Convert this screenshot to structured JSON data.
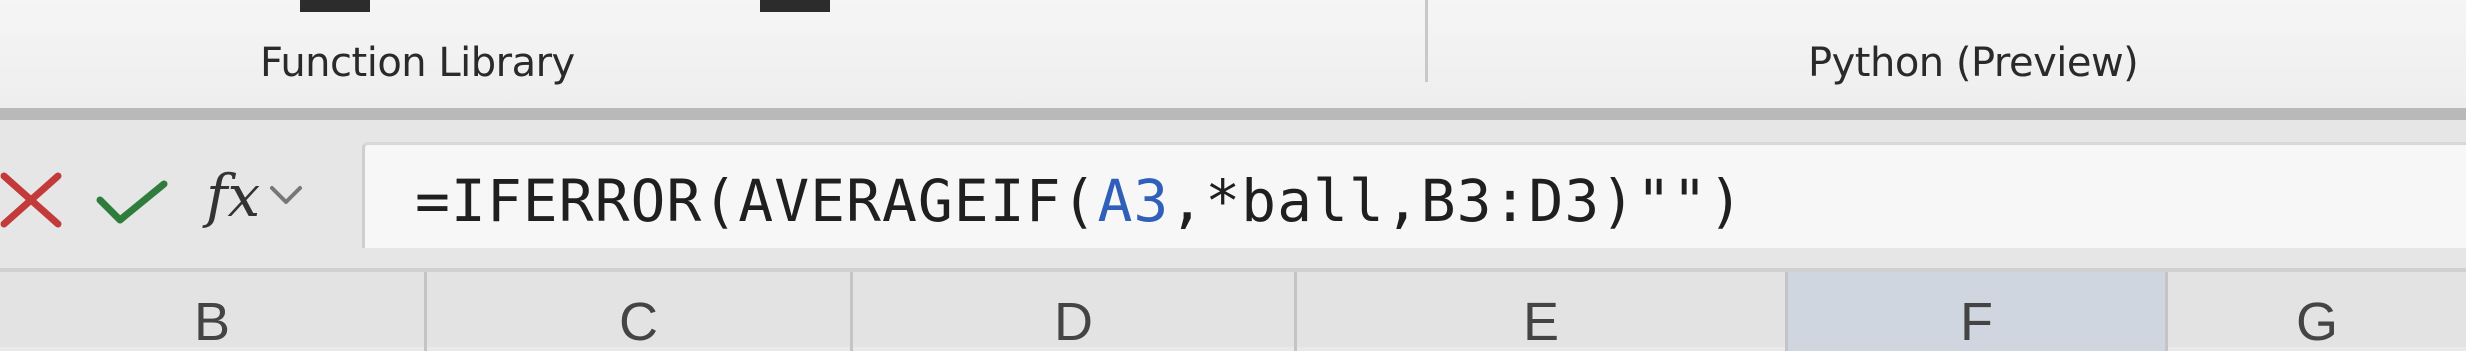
{
  "ribbon": {
    "groups": [
      {
        "label": "Function Library"
      },
      {
        "label": "Python (Preview)"
      }
    ]
  },
  "formula_bar": {
    "cancel_icon": "close-icon",
    "enter_icon": "checkmark-icon",
    "function_label": "fx",
    "formula": {
      "prefix": "=IFERROR(AVERAGEIF(",
      "ref": "A3",
      "suffix": ",*ball,B3:D3)\"\")"
    },
    "colors": {
      "cancel": "#c23a3a",
      "enter": "#2f7d3d",
      "reference": "#2f5fb8"
    }
  },
  "columns": [
    {
      "label": "B",
      "selected": false
    },
    {
      "label": "C",
      "selected": false
    },
    {
      "label": "D",
      "selected": false
    },
    {
      "label": "E",
      "selected": false
    },
    {
      "label": "F",
      "selected": true
    },
    {
      "label": "G",
      "selected": false
    }
  ]
}
